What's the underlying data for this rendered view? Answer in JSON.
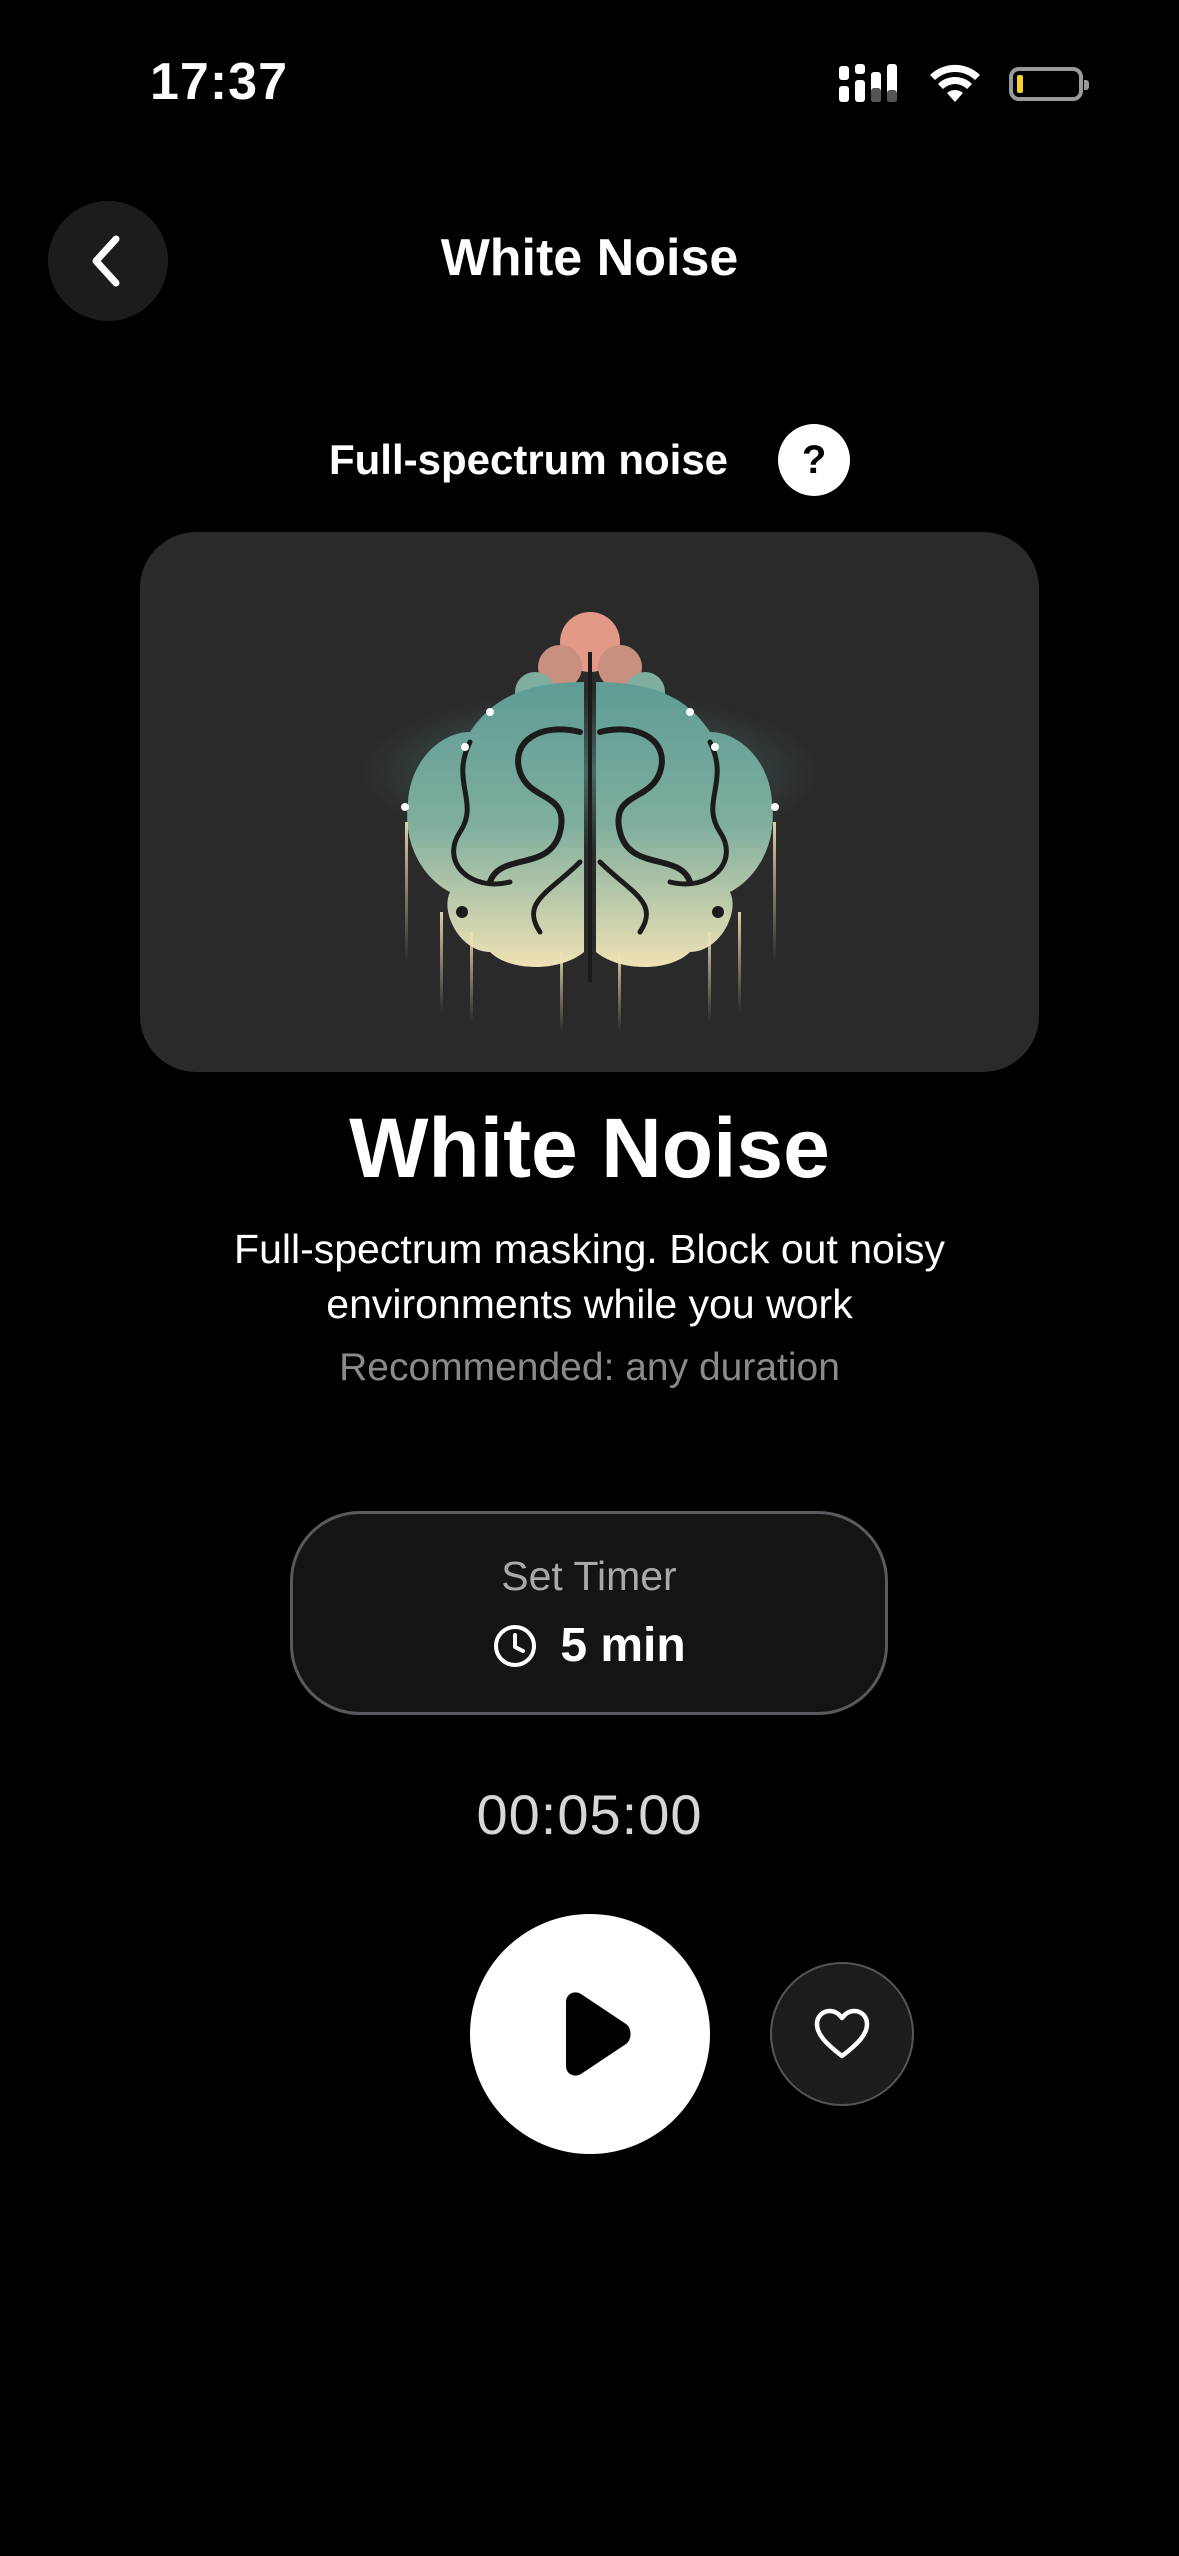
{
  "status_bar": {
    "time": "17:37"
  },
  "header": {
    "title": "White Noise"
  },
  "sound": {
    "subtitle": "Full-spectrum noise",
    "help_label": "?",
    "title": "White Noise",
    "description": "Full-spectrum masking. Block out noisy environments while you work",
    "recommendation": "Recommended: any duration"
  },
  "timer": {
    "label": "Set Timer",
    "value": "5 min",
    "countdown": "00:05:00"
  },
  "icons": {
    "back": "chevron-left-icon",
    "help": "question-icon",
    "clock": "clock-icon",
    "play": "play-icon",
    "favorite": "heart-icon",
    "signal": "cellular-signal-icon",
    "wifi": "wifi-icon",
    "battery": "battery-low-icon"
  },
  "colors": {
    "background": "#000000",
    "card": "#2a2a2b",
    "battery_fill": "#f3d22b",
    "art_teal": "#5f9c94",
    "art_cream": "#efe2b4",
    "art_pink": "#e29a86"
  }
}
